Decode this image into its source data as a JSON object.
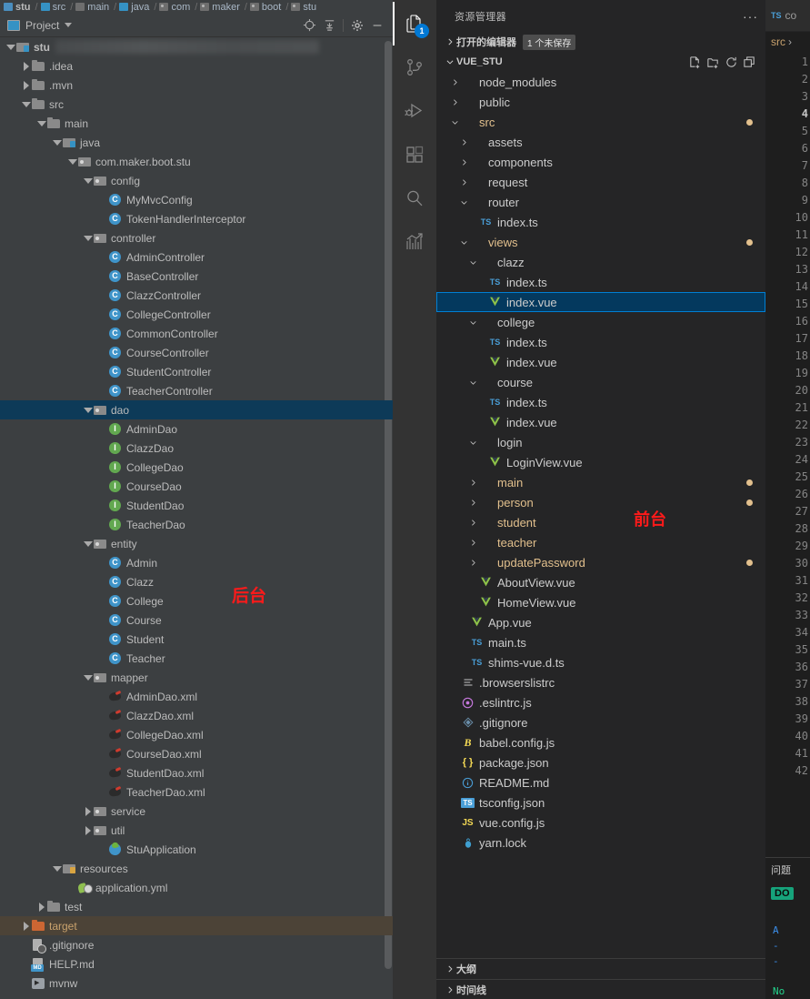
{
  "idea": {
    "breadcrumb": [
      {
        "label": "stu",
        "icon": "module-icon"
      },
      {
        "label": "src",
        "icon": "source-folder-icon"
      },
      {
        "label": "main",
        "icon": "folder-icon"
      },
      {
        "label": "java",
        "icon": "source-folder-icon"
      },
      {
        "label": "com",
        "icon": "package-icon"
      },
      {
        "label": "maker",
        "icon": "package-icon"
      },
      {
        "label": "boot",
        "icon": "package-icon"
      },
      {
        "label": "stu",
        "icon": "package-icon"
      }
    ],
    "toolbar": {
      "panel_title": "Project",
      "icons": [
        "select-opened-file-icon",
        "collapse-all-icon",
        "settings-gear-icon",
        "hide-icon"
      ]
    },
    "annotation": "后台",
    "tree": [
      {
        "label": "stu",
        "indent": 0,
        "arrow": "down",
        "icon": "module-folder-icon",
        "bold": true,
        "blurred_suffix": true
      },
      {
        "label": ".idea",
        "indent": 1,
        "arrow": "right",
        "icon": "folder-icon"
      },
      {
        "label": ".mvn",
        "indent": 1,
        "arrow": "right",
        "icon": "folder-icon"
      },
      {
        "label": "src",
        "indent": 1,
        "arrow": "down",
        "icon": "folder-icon"
      },
      {
        "label": "main",
        "indent": 2,
        "arrow": "down",
        "icon": "folder-icon"
      },
      {
        "label": "java",
        "indent": 3,
        "arrow": "down",
        "icon": "source-folder-icon"
      },
      {
        "label": "com.maker.boot.stu",
        "indent": 4,
        "arrow": "down",
        "icon": "package-icon"
      },
      {
        "label": "config",
        "indent": 5,
        "arrow": "down",
        "icon": "package-icon"
      },
      {
        "label": "MyMvcConfig",
        "indent": 6,
        "arrow": "none",
        "icon": "java-class-icon"
      },
      {
        "label": "TokenHandlerInterceptor",
        "indent": 6,
        "arrow": "none",
        "icon": "java-class-icon"
      },
      {
        "label": "controller",
        "indent": 5,
        "arrow": "down",
        "icon": "package-icon"
      },
      {
        "label": "AdminController",
        "indent": 6,
        "arrow": "none",
        "icon": "java-class-icon"
      },
      {
        "label": "BaseController",
        "indent": 6,
        "arrow": "none",
        "icon": "java-class-icon"
      },
      {
        "label": "ClazzController",
        "indent": 6,
        "arrow": "none",
        "icon": "java-class-icon"
      },
      {
        "label": "CollegeController",
        "indent": 6,
        "arrow": "none",
        "icon": "java-class-icon"
      },
      {
        "label": "CommonController",
        "indent": 6,
        "arrow": "none",
        "icon": "java-class-icon"
      },
      {
        "label": "CourseController",
        "indent": 6,
        "arrow": "none",
        "icon": "java-class-icon"
      },
      {
        "label": "StudentController",
        "indent": 6,
        "arrow": "none",
        "icon": "java-class-icon"
      },
      {
        "label": "TeacherController",
        "indent": 6,
        "arrow": "none",
        "icon": "java-class-icon"
      },
      {
        "label": "dao",
        "indent": 5,
        "arrow": "down",
        "icon": "package-icon",
        "selected": true
      },
      {
        "label": "AdminDao",
        "indent": 6,
        "arrow": "none",
        "icon": "java-interface-icon"
      },
      {
        "label": "ClazzDao",
        "indent": 6,
        "arrow": "none",
        "icon": "java-interface-icon"
      },
      {
        "label": "CollegeDao",
        "indent": 6,
        "arrow": "none",
        "icon": "java-interface-icon"
      },
      {
        "label": "CourseDao",
        "indent": 6,
        "arrow": "none",
        "icon": "java-interface-icon"
      },
      {
        "label": "StudentDao",
        "indent": 6,
        "arrow": "none",
        "icon": "java-interface-icon"
      },
      {
        "label": "TeacherDao",
        "indent": 6,
        "arrow": "none",
        "icon": "java-interface-icon"
      },
      {
        "label": "entity",
        "indent": 5,
        "arrow": "down",
        "icon": "package-icon"
      },
      {
        "label": "Admin",
        "indent": 6,
        "arrow": "none",
        "icon": "java-class-icon"
      },
      {
        "label": "Clazz",
        "indent": 6,
        "arrow": "none",
        "icon": "java-class-icon"
      },
      {
        "label": "College",
        "indent": 6,
        "arrow": "none",
        "icon": "java-class-icon"
      },
      {
        "label": "Course",
        "indent": 6,
        "arrow": "none",
        "icon": "java-class-icon"
      },
      {
        "label": "Student",
        "indent": 6,
        "arrow": "none",
        "icon": "java-class-icon"
      },
      {
        "label": "Teacher",
        "indent": 6,
        "arrow": "none",
        "icon": "java-class-icon"
      },
      {
        "label": "mapper",
        "indent": 5,
        "arrow": "down",
        "icon": "package-icon"
      },
      {
        "label": "AdminDao.xml",
        "indent": 6,
        "arrow": "none",
        "icon": "mybatis-xml-icon"
      },
      {
        "label": "ClazzDao.xml",
        "indent": 6,
        "arrow": "none",
        "icon": "mybatis-xml-icon"
      },
      {
        "label": "CollegeDao.xml",
        "indent": 6,
        "arrow": "none",
        "icon": "mybatis-xml-icon"
      },
      {
        "label": "CourseDao.xml",
        "indent": 6,
        "arrow": "none",
        "icon": "mybatis-xml-icon"
      },
      {
        "label": "StudentDao.xml",
        "indent": 6,
        "arrow": "none",
        "icon": "mybatis-xml-icon"
      },
      {
        "label": "TeacherDao.xml",
        "indent": 6,
        "arrow": "none",
        "icon": "mybatis-xml-icon"
      },
      {
        "label": "service",
        "indent": 5,
        "arrow": "right",
        "icon": "package-icon"
      },
      {
        "label": "util",
        "indent": 5,
        "arrow": "right",
        "icon": "package-icon"
      },
      {
        "label": "StuApplication",
        "indent": 6,
        "arrow": "none",
        "icon": "spring-boot-icon"
      },
      {
        "label": "resources",
        "indent": 3,
        "arrow": "down",
        "icon": "resources-folder-icon"
      },
      {
        "label": "application.yml",
        "indent": 4,
        "arrow": "none",
        "icon": "spring-yaml-icon"
      },
      {
        "label": "test",
        "indent": 2,
        "arrow": "right",
        "icon": "folder-icon"
      },
      {
        "label": "target",
        "indent": 1,
        "arrow": "right",
        "icon": "excluded-folder-icon",
        "excluded": true
      },
      {
        "label": ".gitignore",
        "indent": 1,
        "arrow": "none",
        "icon": "gitignore-icon"
      },
      {
        "label": "HELP.md",
        "indent": 1,
        "arrow": "none",
        "icon": "markdown-icon"
      },
      {
        "label": "mvnw",
        "indent": 1,
        "arrow": "none",
        "icon": "shell-script-icon"
      }
    ]
  },
  "vscode": {
    "activitybar": [
      {
        "name": "explorer-icon",
        "badge": "1",
        "active": true
      },
      {
        "name": "source-control-icon",
        "badge": "",
        "active": false
      },
      {
        "name": "run-and-debug-icon",
        "badge": "",
        "active": false
      },
      {
        "name": "extensions-icon",
        "badge": "",
        "active": false
      },
      {
        "name": "search-icon",
        "badge": "",
        "active": false
      },
      {
        "name": "analytics-icon",
        "badge": "",
        "active": false
      }
    ],
    "sidebar": {
      "title": "资源管理器",
      "more_actions": "···",
      "open_editors": {
        "label": "打开的编辑器",
        "badge": "1 个未保存"
      },
      "root": {
        "label": "VUE_STU",
        "actions": [
          "new-file-icon",
          "new-folder-icon",
          "refresh-icon",
          "collapse-all-icon"
        ]
      },
      "annotation": "前台",
      "tree": [
        {
          "label": "node_modules",
          "indent": 1,
          "chev": "right",
          "icon": "folder-icon"
        },
        {
          "label": "public",
          "indent": 1,
          "chev": "right",
          "icon": "folder-icon"
        },
        {
          "label": "src",
          "indent": 1,
          "chev": "down",
          "icon": "folder-icon",
          "modified": true,
          "dot": true
        },
        {
          "label": "assets",
          "indent": 2,
          "chev": "right",
          "icon": "folder-icon"
        },
        {
          "label": "components",
          "indent": 2,
          "chev": "right",
          "icon": "folder-icon"
        },
        {
          "label": "request",
          "indent": 2,
          "chev": "right",
          "icon": "folder-icon"
        },
        {
          "label": "router",
          "indent": 2,
          "chev": "down",
          "icon": "folder-icon"
        },
        {
          "label": "index.ts",
          "indent": 3,
          "chev": "none",
          "icon": "typescript-icon"
        },
        {
          "label": "views",
          "indent": 2,
          "chev": "down",
          "icon": "folder-icon",
          "modified": true,
          "dot": true
        },
        {
          "label": "clazz",
          "indent": 3,
          "chev": "down",
          "icon": "folder-icon"
        },
        {
          "label": "index.ts",
          "indent": 4,
          "chev": "none",
          "icon": "typescript-icon"
        },
        {
          "label": "index.vue",
          "indent": 4,
          "chev": "none",
          "icon": "vue-icon",
          "selected": true
        },
        {
          "label": "college",
          "indent": 3,
          "chev": "down",
          "icon": "folder-icon"
        },
        {
          "label": "index.ts",
          "indent": 4,
          "chev": "none",
          "icon": "typescript-icon"
        },
        {
          "label": "index.vue",
          "indent": 4,
          "chev": "none",
          "icon": "vue-icon"
        },
        {
          "label": "course",
          "indent": 3,
          "chev": "down",
          "icon": "folder-icon"
        },
        {
          "label": "index.ts",
          "indent": 4,
          "chev": "none",
          "icon": "typescript-icon"
        },
        {
          "label": "index.vue",
          "indent": 4,
          "chev": "none",
          "icon": "vue-icon"
        },
        {
          "label": "login",
          "indent": 3,
          "chev": "down",
          "icon": "folder-icon"
        },
        {
          "label": "LoginView.vue",
          "indent": 4,
          "chev": "none",
          "icon": "vue-icon"
        },
        {
          "label": "main",
          "indent": 3,
          "chev": "right",
          "icon": "folder-icon",
          "modified": true,
          "dot": true
        },
        {
          "label": "person",
          "indent": 3,
          "chev": "right",
          "icon": "folder-icon",
          "modified": true,
          "dot": true
        },
        {
          "label": "student",
          "indent": 3,
          "chev": "right",
          "icon": "folder-icon",
          "modified": true
        },
        {
          "label": "teacher",
          "indent": 3,
          "chev": "right",
          "icon": "folder-icon",
          "modified": true
        },
        {
          "label": "updatePassword",
          "indent": 3,
          "chev": "right",
          "icon": "folder-icon",
          "modified": true,
          "dot": true
        },
        {
          "label": "AboutView.vue",
          "indent": 3,
          "chev": "none",
          "icon": "vue-icon"
        },
        {
          "label": "HomeView.vue",
          "indent": 3,
          "chev": "none",
          "icon": "vue-icon"
        },
        {
          "label": "App.vue",
          "indent": 2,
          "chev": "none",
          "icon": "vue-icon"
        },
        {
          "label": "main.ts",
          "indent": 2,
          "chev": "none",
          "icon": "typescript-icon"
        },
        {
          "label": "shims-vue.d.ts",
          "indent": 2,
          "chev": "none",
          "icon": "typescript-icon"
        },
        {
          "label": ".browserslistrc",
          "indent": 1,
          "chev": "none",
          "icon": "config-list-icon"
        },
        {
          "label": ".eslintrc.js",
          "indent": 1,
          "chev": "none",
          "icon": "eslint-icon"
        },
        {
          "label": ".gitignore",
          "indent": 1,
          "chev": "none",
          "icon": "git-icon"
        },
        {
          "label": "babel.config.js",
          "indent": 1,
          "chev": "none",
          "icon": "babel-icon"
        },
        {
          "label": "package.json",
          "indent": 1,
          "chev": "none",
          "icon": "json-icon"
        },
        {
          "label": "README.md",
          "indent": 1,
          "chev": "none",
          "icon": "readme-icon"
        },
        {
          "label": "tsconfig.json",
          "indent": 1,
          "chev": "none",
          "icon": "tsconfig-icon"
        },
        {
          "label": "vue.config.js",
          "indent": 1,
          "chev": "none",
          "icon": "javascript-icon"
        },
        {
          "label": "yarn.lock",
          "indent": 1,
          "chev": "none",
          "icon": "yarn-icon"
        }
      ],
      "bottom_sections": [
        {
          "label": "大纲"
        },
        {
          "label": "时间线"
        }
      ]
    },
    "editor": {
      "tab": {
        "icon": "typescript-icon",
        "label": "co"
      },
      "breadcrumb": "src",
      "line_numbers": [
        1,
        2,
        3,
        4,
        5,
        6,
        7,
        8,
        9,
        10,
        11,
        12,
        13,
        14,
        15,
        16,
        17,
        18,
        19,
        20,
        21,
        22,
        23,
        24,
        25,
        26,
        27,
        28,
        29,
        30,
        31,
        32,
        33,
        34,
        35,
        36,
        37,
        38,
        39,
        40,
        41,
        42
      ],
      "current_line": 4,
      "panel": {
        "tab_label": "问题",
        "badge": "DO",
        "lines": [
          "A",
          "-",
          "-",
          "No"
        ]
      }
    }
  },
  "colors": {
    "idea_bg": "#3c3f41",
    "idea_selection": "#0d3a58",
    "idea_excluded": "#4c4337",
    "vscode_bg": "#1e1e1e",
    "vscode_sidebar": "#252526",
    "vscode_selection": "#04395e",
    "vscode_focus_border": "#007fd4",
    "modified_yellow": "#e2c08d",
    "annotation_red": "#ff1a1a",
    "vue_green": "#8dc149",
    "ts_blue": "#4a9fd8"
  }
}
